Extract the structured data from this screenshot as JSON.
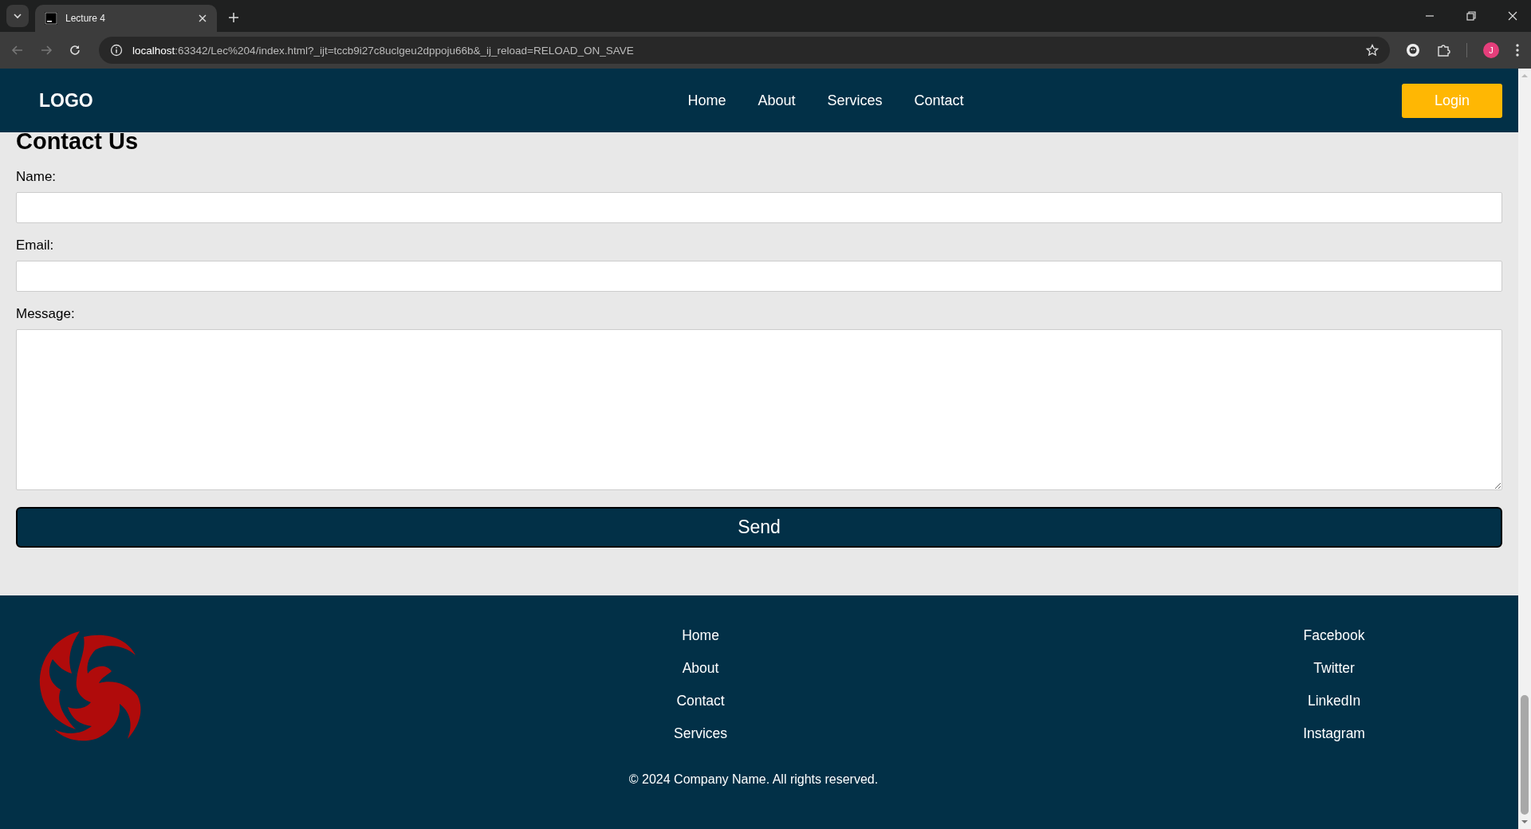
{
  "browser": {
    "tabs": [
      {
        "title": "Lecture 4",
        "selected": true
      }
    ],
    "url_host": "localhost",
    "url_rest": ":63342/Lec%204/index.html?_ijt=tccb9i27c8uclgeu2dppoju66b&_ij_reload=RELOAD_ON_SAVE",
    "profile_initial": "J"
  },
  "header": {
    "logo": "LOGO",
    "nav": [
      "Home",
      "About",
      "Services",
      "Contact"
    ],
    "login": "Login"
  },
  "contact": {
    "title": "Contact Us",
    "fields": [
      {
        "label": "Name:",
        "kind": "input"
      },
      {
        "label": "Email:",
        "kind": "input"
      },
      {
        "label": "Message:",
        "kind": "textarea"
      }
    ],
    "submit": "Send"
  },
  "footer": {
    "links": [
      "Home",
      "About",
      "Contact",
      "Services"
    ],
    "social": [
      "Facebook",
      "Twitter",
      "LinkedIn",
      "Instagram"
    ],
    "copyright": "© 2024 Company Name. All rights reserved."
  }
}
